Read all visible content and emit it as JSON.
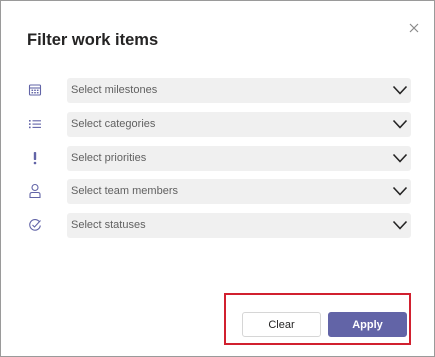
{
  "dialog": {
    "title": "Filter work items",
    "close_icon": "close-icon"
  },
  "filters": [
    {
      "key": "milestones",
      "icon": "calendar-icon",
      "placeholder": "Select milestones"
    },
    {
      "key": "categories",
      "icon": "list-icon",
      "placeholder": "Select categories"
    },
    {
      "key": "priorities",
      "icon": "exclamation-icon",
      "placeholder": "Select priorities"
    },
    {
      "key": "team_members",
      "icon": "person-icon",
      "placeholder": "Select team members"
    },
    {
      "key": "statuses",
      "icon": "status-icon",
      "placeholder": "Select statuses"
    }
  ],
  "actions": {
    "clear_label": "Clear",
    "apply_label": "Apply"
  },
  "colors": {
    "accent": "#6264a7",
    "icon": "#6264a7",
    "field_bg": "#f0f0f0",
    "highlight": "#d1202f"
  }
}
